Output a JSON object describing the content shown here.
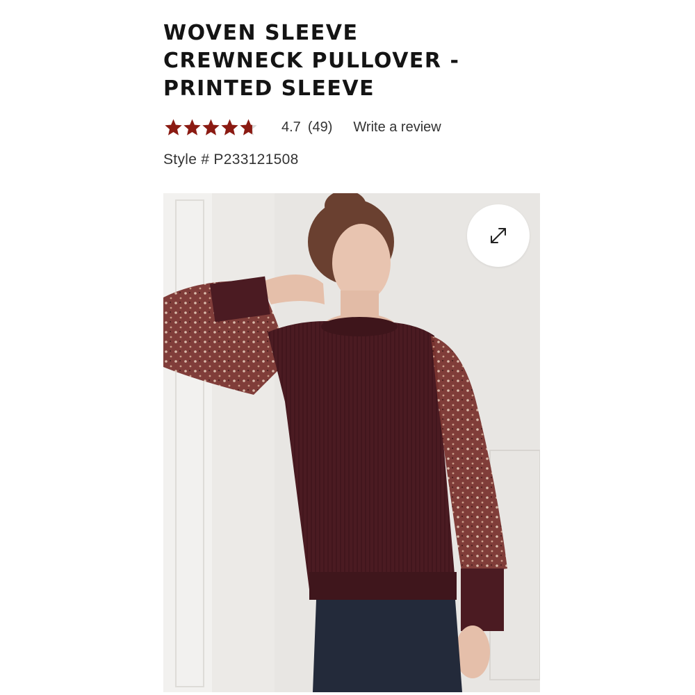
{
  "product": {
    "title_lines": [
      "WOVEN SLEEVE",
      "CREWNECK PULLOVER -",
      "PRINTED SLEEVE"
    ],
    "rating": {
      "stars_value": 4.7,
      "stars_max": 5,
      "value_text": "4.7",
      "count_text": "(49)",
      "write_review_label": "Write a review",
      "star_color": "#8b1a12",
      "star_empty_color": "#d8d8d8"
    },
    "style_label": "Style # P233121508"
  },
  "image": {
    "expand_icon": "expand-arrows-icon",
    "sweater_color": "#4b1b22",
    "sleeve_color": "#6b2a2a",
    "background_color": "#e9e8e6"
  }
}
